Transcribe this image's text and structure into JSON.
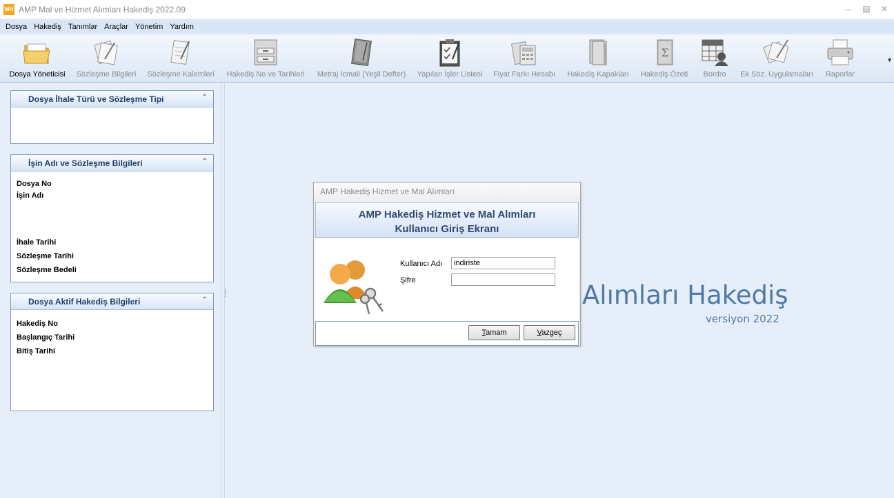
{
  "app": {
    "icon_text": "MH",
    "title": "AMP Mal ve Hizmet Alımları Hakediş  2022.09",
    "window_controls": [
      "minimize-icon",
      "maximize-icon",
      "close-icon"
    ]
  },
  "menu": [
    "Dosya",
    "Hakediş",
    "Tanımlar",
    "Araçlar",
    "Yönetim",
    "Yardım"
  ],
  "toolbar": [
    {
      "label": "Dosya Yöneticisi",
      "icon": "folder-icon",
      "active": true
    },
    {
      "label": "Sözleşme Bilgileri",
      "icon": "documents-icon",
      "active": false
    },
    {
      "label": "Sözleşme Kalemleri",
      "icon": "notepad-icon",
      "active": false
    },
    {
      "label": "Hakediş No ve Tarihleri",
      "icon": "file-cabinet-icon",
      "active": false
    },
    {
      "label": "Metraj İcmali (Yeşil Defter)",
      "icon": "book-icon",
      "active": false
    },
    {
      "label": "Yapılan İşler Listesi",
      "icon": "clipboard-icon",
      "active": false
    },
    {
      "label": "Fiyat Farkı Hesabı",
      "icon": "calculator-icon",
      "active": false
    },
    {
      "label": "Hakediş Kapakları",
      "icon": "folder-stack-icon",
      "active": false
    },
    {
      "label": "Hakediş Özeti",
      "icon": "sigma-icon",
      "active": false
    },
    {
      "label": "Bordro",
      "icon": "table-user-icon",
      "active": false
    },
    {
      "label": "Ek Söz. Uygulamaları",
      "icon": "papers-pen-icon",
      "active": false
    },
    {
      "label": "Raporlar",
      "icon": "printer-icon",
      "active": false
    }
  ],
  "left_panel": {
    "group1": {
      "title": "Dosya İhale Türü ve Sözleşme Tipi"
    },
    "group2": {
      "title": "İşin Adı ve Sözleşme Bilgileri",
      "dosya_no": "Dosya No",
      "isin_adi": "İşin Adı",
      "ihale_tarihi": "İhale Tarihi",
      "sozlesme_tarihi": "Sözleşme Tarihi",
      "sozlesme_bedeli": "Sözleşme Bedeli"
    },
    "group3": {
      "title": "Dosya Aktif Hakediş Bilgileri",
      "hakedis_no": "Hakediş No",
      "baslangic_tarihi": "Başlangıç Tarihi",
      "bitis_tarihi": "Bitiş Tarihi"
    }
  },
  "main": {
    "big_title": "Alımları Hakediş",
    "version": "versiyon 2022"
  },
  "dialog": {
    "window_title": "AMP Hakediş Hizmet ve Mal Alımları",
    "heading_line1": "AMP Hakediş Hizmet ve Mal Alımları",
    "heading_line2": "Kullanıcı Giriş Ekranı",
    "username_label": "Kullanıcı Adı",
    "username_value": "indiriste",
    "password_label": "Şifre",
    "password_value": "",
    "ok_button": {
      "mnemonic": "T",
      "rest": "amam"
    },
    "cancel_button": {
      "mnemonic": "V",
      "rest": "azgeç"
    }
  }
}
